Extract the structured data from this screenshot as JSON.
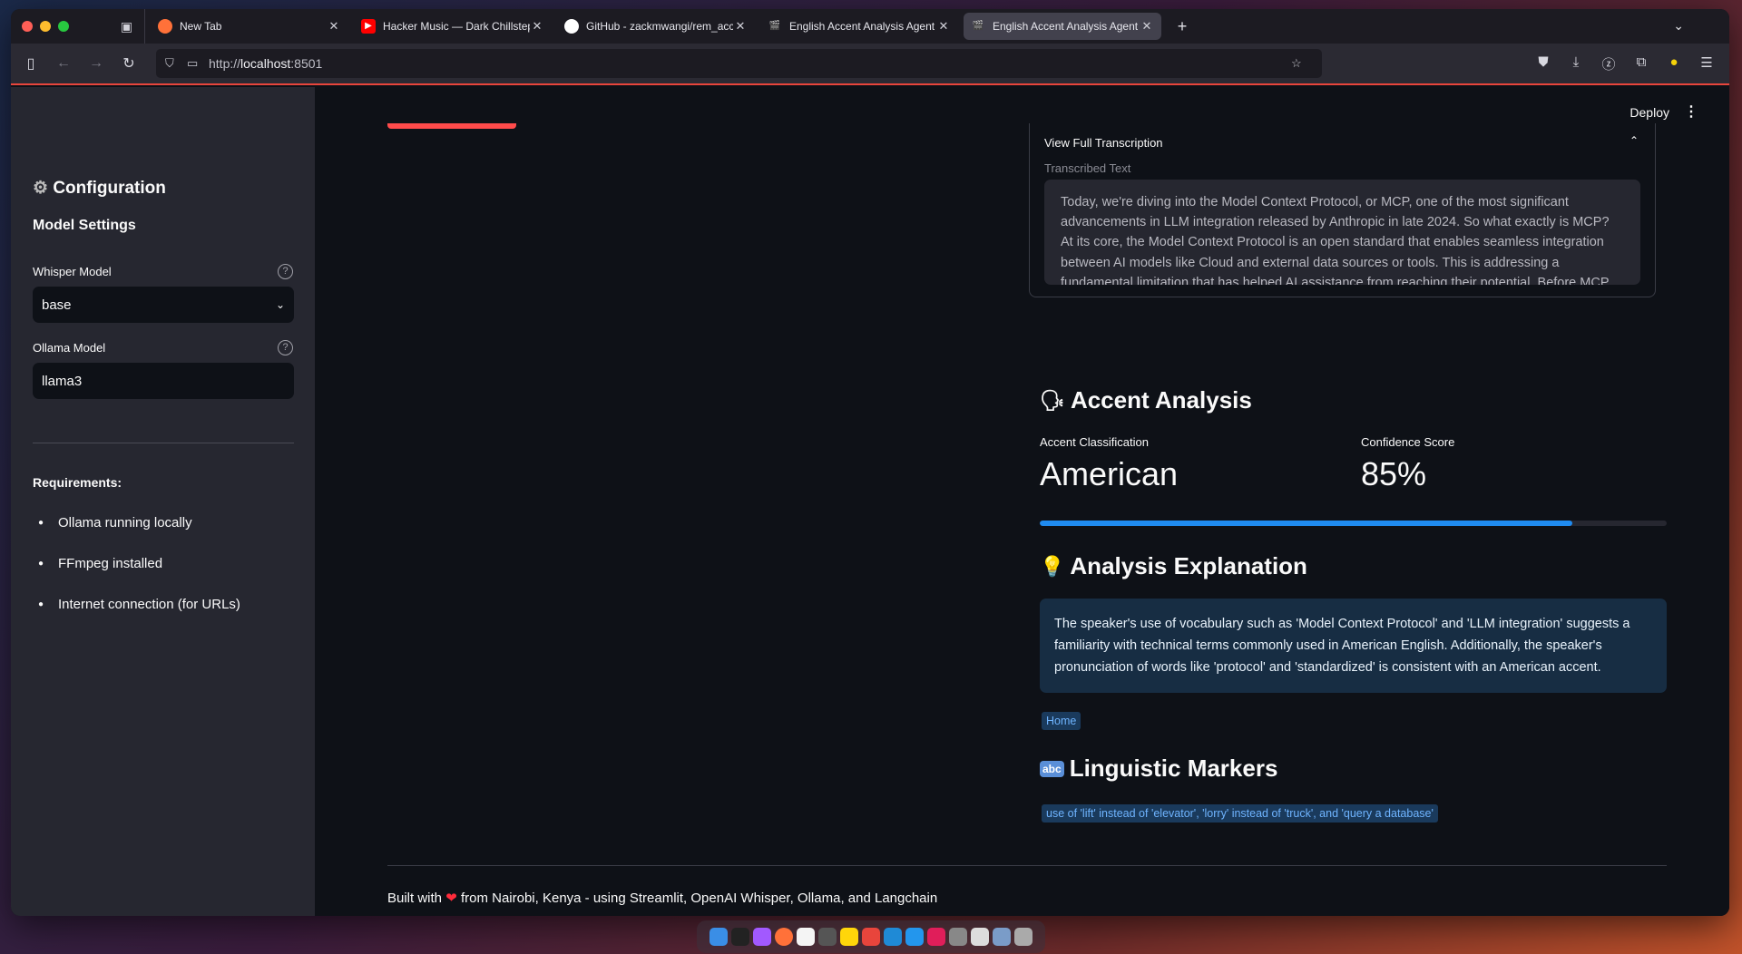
{
  "browser": {
    "tabs": [
      {
        "title": "New Tab",
        "icon": "firefox-icon",
        "color": "#ff7139"
      },
      {
        "title": "Hacker Music — Dark Chillstep P",
        "icon": "youtube-icon",
        "color": "#ff0000"
      },
      {
        "title": "GitHub - zackmwangi/rem_acce",
        "icon": "github-icon",
        "color": "#ffffff"
      },
      {
        "title": "English Accent Analysis Agent (",
        "icon": "streamlit-icon",
        "color": "#6bbf59"
      },
      {
        "title": "English Accent Analysis Agent (",
        "icon": "streamlit-icon",
        "color": "#cccccc",
        "active": true
      }
    ],
    "url_prefix": "http://",
    "url_host": "localhost",
    "url_suffix": ":8501"
  },
  "sidebar": {
    "title": "Configuration",
    "title_icon": "gear-icon",
    "model_settings": "Model Settings",
    "whisper_label": "Whisper Model",
    "whisper_value": "base",
    "ollama_label": "Ollama Model",
    "ollama_value": "llama3",
    "requirements_title": "Requirements:",
    "requirements": [
      "Ollama running locally",
      "FFmpeg installed",
      "Internet connection (for URLs)"
    ]
  },
  "header": {
    "deploy": "Deploy"
  },
  "transcription": {
    "expander_title": "View Full Transcription",
    "label": "Transcribed Text",
    "text": " Today, we're diving into the Model Context Protocol, or MCP, one of the most significant advancements in LLM integration released by Anthropic in late 2024. So what exactly is MCP? At its core, the Model Context Protocol is an open standard that enables seamless integration between AI models like Cloud and external data sources or tools. This is addressing a fundamental limitation that has helped AI assistance from reaching their potential. Before MCP, connecting models to each new data source require custom implementations which can"
  },
  "accent": {
    "heading": "Accent Analysis",
    "heading_icon": "speaking-head-icon",
    "classification_label": "Accent Classification",
    "classification_value": "American",
    "confidence_label": "Confidence Score",
    "confidence_value": "85%",
    "confidence_fraction": 0.85
  },
  "explanation": {
    "heading": "Analysis Explanation",
    "heading_icon": "lightbulb-icon",
    "text": "The speaker's use of vocabulary such as 'Model Context Protocol' and 'LLM integration' suggests a familiarity with technical terms commonly used in American English. Additionally, the speaker's pronunciation of words like 'protocol' and 'standardized' is consistent with an American accent.",
    "chip": "Home"
  },
  "markers": {
    "heading": "Linguistic Markers",
    "heading_icon": "abc-icon",
    "chip": "use of 'lift' instead of 'elevator', 'lorry' instead of 'truck', and 'query a database'"
  },
  "footer": {
    "prefix": "Built with",
    "suffix": "from Nairobi, Kenya - using Streamlit, OpenAI Whisper, Ollama, and Langchain"
  },
  "colors": {
    "accent_red": "#ff4b4b",
    "progress_blue": "#1f8bf0",
    "info_bg": "#172d43"
  }
}
